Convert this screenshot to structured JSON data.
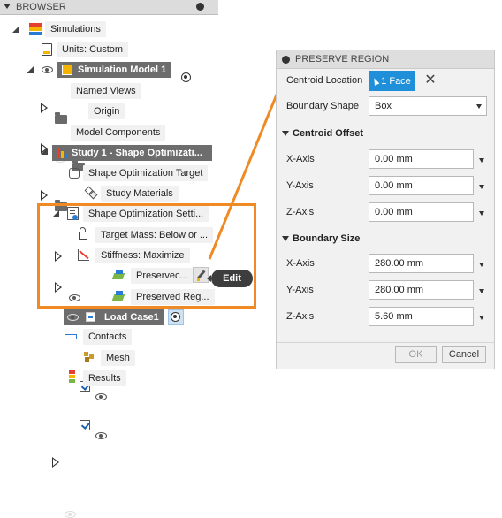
{
  "browser": {
    "header_title": "BROWSER",
    "root_label": "Simulations",
    "units_label": "Units: Custom",
    "sim_model_label": "Simulation Model 1",
    "named_views_label": "Named Views",
    "origin_label": "Origin",
    "model_components_label": "Model Components",
    "study_label": "Study 1 - Shape Optimizati...",
    "shape_opt_target_label": "Shape Optimization Target",
    "study_materials_label": "Study Materials",
    "shape_opt_settings_label": "Shape Optimization Setti...",
    "target_mass_label": "Target Mass: Below or ...",
    "stiffness_label": "Stiffness: Maximize",
    "preserve_1_label": "Preservec...",
    "preserve_2_label": "Preserved Reg...",
    "load_case_label": "Load Case1",
    "contacts_label": "Contacts",
    "mesh_label": "Mesh",
    "results_label": "Results"
  },
  "tooltip": {
    "edit_label": "Edit"
  },
  "panel": {
    "title": "PRESERVE REGION",
    "centroid_location_label": "Centroid Location",
    "face_selection": "1 Face",
    "clear_symbol": "✕",
    "boundary_shape_label": "Boundary Shape",
    "boundary_shape_value": "Box",
    "centroid_offset_heading": "Centroid Offset",
    "centroid_offset": [
      {
        "axis": "X-Axis",
        "value": "0.00 mm"
      },
      {
        "axis": "Y-Axis",
        "value": "0.00 mm"
      },
      {
        "axis": "Z-Axis",
        "value": "0.00 mm"
      }
    ],
    "boundary_size_heading": "Boundary Size",
    "boundary_size": [
      {
        "axis": "X-Axis",
        "value": "280.00 mm"
      },
      {
        "axis": "Y-Axis",
        "value": "280.00 mm"
      },
      {
        "axis": "Z-Axis",
        "value": "5.60 mm"
      }
    ],
    "ok_label": "OK",
    "cancel_label": "Cancel"
  },
  "colors": {
    "highlight": "#f08a24",
    "accent_blue": "#1e8fd8",
    "dark_row": "#6d6d6d"
  }
}
